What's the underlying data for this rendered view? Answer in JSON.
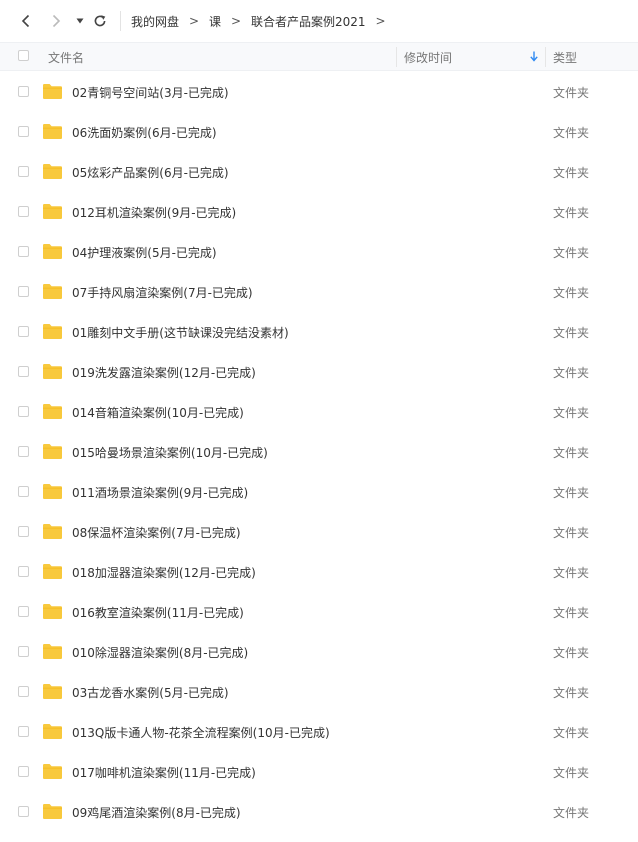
{
  "breadcrumb": [
    "我的网盘",
    "课",
    "联合者产品案例2021"
  ],
  "breadcrumb_separator": ">",
  "columns": {
    "name": "文件名",
    "modified": "修改时间",
    "type": "类型"
  },
  "icons": {
    "back": "chevron-left-icon",
    "forward": "chevron-right-icon",
    "history": "caret-down-icon",
    "refresh": "refresh-icon",
    "sort": "arrow-down-icon",
    "folder": "folder-icon"
  },
  "colors": {
    "folder": "#F8C93D",
    "sort_arrow": "#2F8AF2"
  },
  "files": [
    {
      "name": "02青铜号空间站(3月-已完成)",
      "type": "文件夹"
    },
    {
      "name": "06洗面奶案例(6月-已完成)",
      "type": "文件夹"
    },
    {
      "name": "05炫彩产品案例(6月-已完成)",
      "type": "文件夹"
    },
    {
      "name": "012耳机渲染案例(9月-已完成)",
      "type": "文件夹"
    },
    {
      "name": "04护理液案例(5月-已完成)",
      "type": "文件夹"
    },
    {
      "name": "07手持风扇渲染案例(7月-已完成)",
      "type": "文件夹"
    },
    {
      "name": "01雕刻中文手册(这节缺课没完结没素材)",
      "type": "文件夹"
    },
    {
      "name": "019洗发露渲染案例(12月-已完成)",
      "type": "文件夹"
    },
    {
      "name": "014音箱渲染案例(10月-已完成)",
      "type": "文件夹"
    },
    {
      "name": "015哈曼场景渲染案例(10月-已完成)",
      "type": "文件夹"
    },
    {
      "name": "011酒场景渲染案例(9月-已完成)",
      "type": "文件夹"
    },
    {
      "name": "08保温杯渲染案例(7月-已完成)",
      "type": "文件夹"
    },
    {
      "name": "018加湿器渲染案例(12月-已完成)",
      "type": "文件夹"
    },
    {
      "name": "016教室渲染案例(11月-已完成)",
      "type": "文件夹"
    },
    {
      "name": "010除湿器渲染案例(8月-已完成)",
      "type": "文件夹"
    },
    {
      "name": "03古龙香水案例(5月-已完成)",
      "type": "文件夹"
    },
    {
      "name": "013Q版卡通人物-花茶全流程案例(10月-已完成)",
      "type": "文件夹"
    },
    {
      "name": "017咖啡机渲染案例(11月-已完成)",
      "type": "文件夹"
    },
    {
      "name": "09鸡尾酒渲染案例(8月-已完成)",
      "type": "文件夹"
    }
  ]
}
